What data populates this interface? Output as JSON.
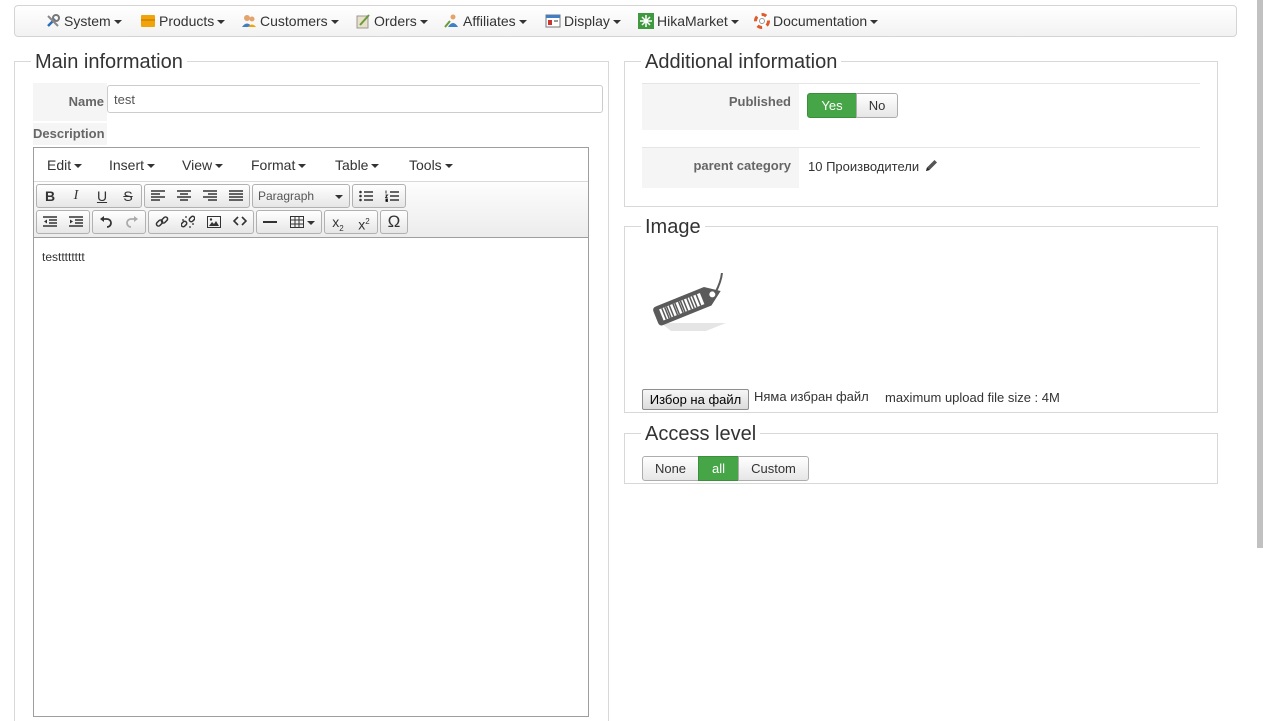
{
  "menu": [
    {
      "label": "System",
      "icon": "tools-icon"
    },
    {
      "label": "Products",
      "icon": "products-icon"
    },
    {
      "label": "Customers",
      "icon": "customers-icon"
    },
    {
      "label": "Orders",
      "icon": "orders-icon"
    },
    {
      "label": "Affiliates",
      "icon": "affiliates-icon"
    },
    {
      "label": "Display",
      "icon": "display-icon"
    },
    {
      "label": "HikaMarket",
      "icon": "hikamarket-icon"
    },
    {
      "label": "Documentation",
      "icon": "lifebuoy-icon"
    }
  ],
  "main": {
    "legend": "Main information",
    "name_label": "Name",
    "name_value": "test",
    "description_label": "Description",
    "editor": {
      "menus": [
        "Edit",
        "Insert",
        "View",
        "Format",
        "Table",
        "Tools"
      ],
      "format_select": "Paragraph",
      "content": "testttttttt"
    }
  },
  "additional": {
    "legend": "Additional information",
    "published_label": "Published",
    "published_options": [
      "Yes",
      "No"
    ],
    "published_selected": "Yes",
    "parent_label": "parent category",
    "parent_value": "10 Производители"
  },
  "image": {
    "legend": "Image",
    "file_button": "Избор на файл",
    "no_file": "Няма избран файл",
    "max_size": "maximum upload file size : 4M"
  },
  "access": {
    "legend": "Access level",
    "options": [
      "None",
      "all",
      "Custom"
    ],
    "selected": "all"
  },
  "colors": {
    "active_green": "#46a546"
  }
}
